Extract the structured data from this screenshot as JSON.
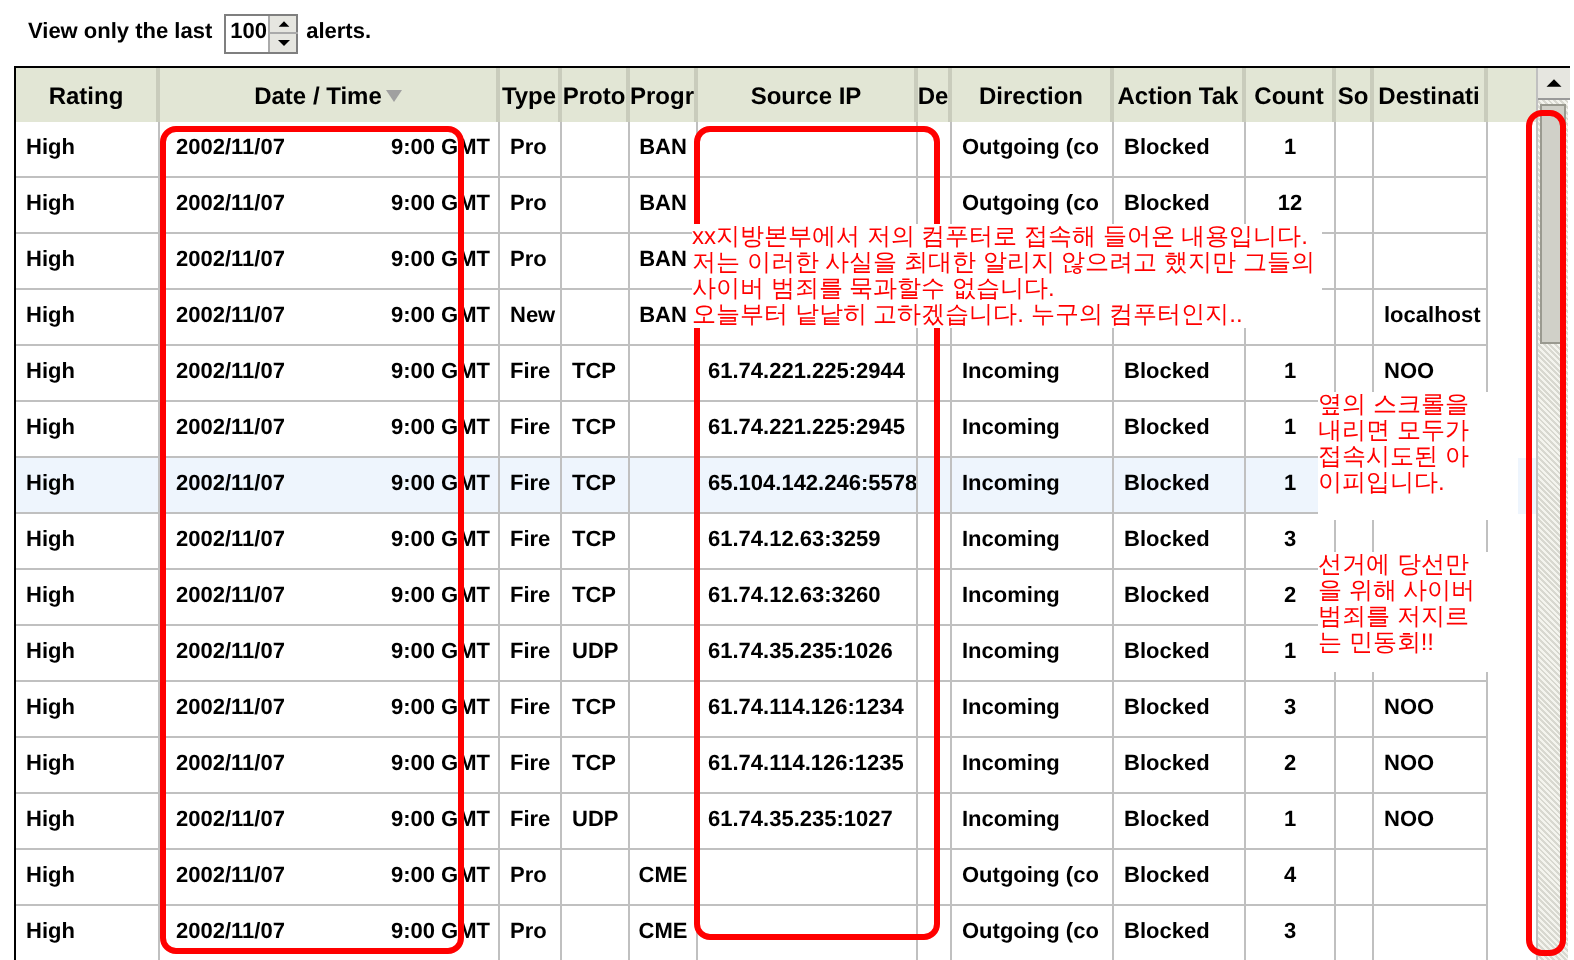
{
  "filter": {
    "label_before": "View only the last",
    "value": "100",
    "label_after": "alerts."
  },
  "table": {
    "columns": [
      {
        "label": "Rating",
        "sorted": false
      },
      {
        "label": "Date / Time",
        "sorted": true
      },
      {
        "label": "Type",
        "sorted": false
      },
      {
        "label": "Proto",
        "sorted": false
      },
      {
        "label": "Progr",
        "sorted": false
      },
      {
        "label": "Source IP",
        "sorted": false
      },
      {
        "label": "De",
        "sorted": false
      },
      {
        "label": "Direction",
        "sorted": false
      },
      {
        "label": "Action Tak",
        "sorted": false
      },
      {
        "label": "Count",
        "sorted": false
      },
      {
        "label": "So",
        "sorted": false
      },
      {
        "label": "Destinati",
        "sorted": false
      }
    ],
    "rows": [
      {
        "selected": false,
        "cells": [
          "High",
          {
            "left": "2002/11/07",
            "right": "9:00 GMT"
          },
          "Pro",
          "",
          "BAN",
          "",
          "",
          "Outgoing (co",
          "Blocked",
          "1",
          "",
          ""
        ]
      },
      {
        "selected": false,
        "cells": [
          "High",
          {
            "left": "2002/11/07",
            "right": "9:00 GMT"
          },
          "Pro",
          "",
          "BAN",
          "",
          "",
          "Outgoing (co",
          "Blocked",
          "12",
          "",
          ""
        ]
      },
      {
        "selected": false,
        "cells": [
          "High",
          {
            "left": "2002/11/07",
            "right": "9:00 GMT"
          },
          "Pro",
          "",
          "BAN",
          "",
          "",
          "",
          "",
          "",
          "",
          ""
        ]
      },
      {
        "selected": false,
        "cells": [
          "High",
          {
            "left": "2002/11/07",
            "right": "9:00 GMT"
          },
          "New",
          "",
          "BAN",
          "",
          "",
          "",
          "",
          "",
          "",
          "localhost"
        ]
      },
      {
        "selected": false,
        "cells": [
          "High",
          {
            "left": "2002/11/07",
            "right": "9:00 GMT"
          },
          "Fire",
          "TCP",
          "",
          "61.74.221.225:2944",
          "",
          "Incoming",
          "Blocked",
          "1",
          "",
          "NOO"
        ]
      },
      {
        "selected": false,
        "cells": [
          "High",
          {
            "left": "2002/11/07",
            "right": "9:00 GMT"
          },
          "Fire",
          "TCP",
          "",
          "61.74.221.225:2945",
          "",
          "Incoming",
          "Blocked",
          "1",
          "",
          ""
        ]
      },
      {
        "selected": true,
        "cells": [
          "High",
          {
            "left": "2002/11/07",
            "right": "9:00 GMT"
          },
          "Fire",
          "TCP",
          "",
          "65.104.142.246:5578",
          "",
          "Incoming",
          "Blocked",
          "1",
          "",
          ""
        ]
      },
      {
        "selected": false,
        "cells": [
          "High",
          {
            "left": "2002/11/07",
            "right": "9:00 GMT"
          },
          "Fire",
          "TCP",
          "",
          "61.74.12.63:3259",
          "",
          "Incoming",
          "Blocked",
          "3",
          "",
          ""
        ]
      },
      {
        "selected": false,
        "cells": [
          "High",
          {
            "left": "2002/11/07",
            "right": "9:00 GMT"
          },
          "Fire",
          "TCP",
          "",
          "61.74.12.63:3260",
          "",
          "Incoming",
          "Blocked",
          "2",
          "",
          ""
        ]
      },
      {
        "selected": false,
        "cells": [
          "High",
          {
            "left": "2002/11/07",
            "right": "9:00 GMT"
          },
          "Fire",
          "UDP",
          "",
          "61.74.35.235:1026",
          "",
          "Incoming",
          "Blocked",
          "1",
          "",
          ""
        ]
      },
      {
        "selected": false,
        "cells": [
          "High",
          {
            "left": "2002/11/07",
            "right": "9:00 GMT"
          },
          "Fire",
          "TCP",
          "",
          "61.74.114.126:1234",
          "",
          "Incoming",
          "Blocked",
          "3",
          "",
          "NOO"
        ]
      },
      {
        "selected": false,
        "cells": [
          "High",
          {
            "left": "2002/11/07",
            "right": "9:00 GMT"
          },
          "Fire",
          "TCP",
          "",
          "61.74.114.126:1235",
          "",
          "Incoming",
          "Blocked",
          "2",
          "",
          "NOO"
        ]
      },
      {
        "selected": false,
        "cells": [
          "High",
          {
            "left": "2002/11/07",
            "right": "9:00 GMT"
          },
          "Fire",
          "UDP",
          "",
          "61.74.35.235:1027",
          "",
          "Incoming",
          "Blocked",
          "1",
          "",
          "NOO"
        ]
      },
      {
        "selected": false,
        "cells": [
          "High",
          {
            "left": "2002/11/07",
            "right": "9:00 GMT"
          },
          "Pro",
          "",
          "CME",
          "",
          "",
          "Outgoing (co",
          "Blocked",
          "4",
          "",
          ""
        ]
      },
      {
        "selected": false,
        "cells": [
          "High",
          {
            "left": "2002/11/07",
            "right": "9:00 GMT"
          },
          "Pro",
          "",
          "CME",
          "",
          "",
          "Outgoing (co",
          "Blocked",
          "3",
          "",
          ""
        ]
      }
    ]
  },
  "annotations": [
    {
      "kind": "note",
      "lines": [
        "xx지방본부에서 저의 컴푸터로 접속해 들어온 내용입니다.",
        "저는 이러한 사실을 최대한 알리지 않으려고 했지만 그들의",
        "사이버 범죄를 묵과할수 없습니다.",
        "오늘부터 낱낱히 고하겠습니다. 누구의 컴푸터인지.."
      ]
    },
    {
      "kind": "side",
      "lines": [
        "옆의 스크롤을",
        "내리면 모두가",
        "접속시도된 아",
        "이피입니다."
      ]
    },
    {
      "kind": "side2",
      "lines": [
        "선거에 당선만",
        "을 위해 사이버",
        "범죄를 저지르",
        "는 민동회!!"
      ]
    }
  ]
}
